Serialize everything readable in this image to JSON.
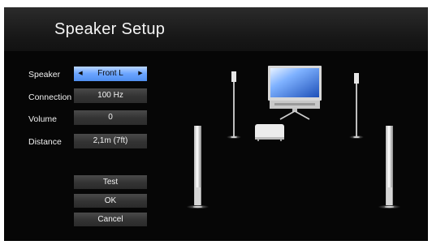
{
  "header": {
    "title": "Speaker Setup"
  },
  "settings": {
    "speaker": {
      "label": "Speaker",
      "value": "Front L"
    },
    "connection": {
      "label": "Connection",
      "value": "100 Hz"
    },
    "volume": {
      "label": "Volume",
      "value": "0"
    },
    "distance": {
      "label": "Distance",
      "value": "2,1m (7ft)"
    }
  },
  "buttons": {
    "test": "Test",
    "ok": "OK",
    "cancel": "Cancel"
  },
  "icons": {
    "prev": "arrow-left-icon",
    "next": "arrow-right-icon"
  },
  "colors": {
    "background": "#060606",
    "accent": "#6aa4ff",
    "field": "#3a3a3a"
  }
}
